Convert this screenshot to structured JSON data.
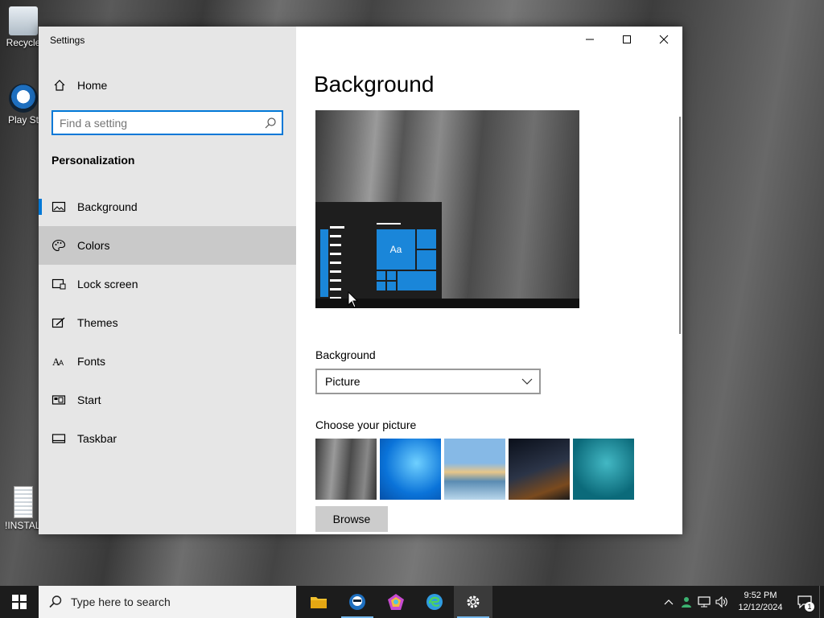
{
  "desktop": {
    "icons": [
      {
        "label": "Recycle",
        "icon": "recycle-bin-icon"
      },
      {
        "label": "Play St",
        "icon": "play-store-icon"
      },
      {
        "label": "!INSTALL",
        "icon": "install-file-icon"
      }
    ]
  },
  "window": {
    "title": "Settings",
    "controls": {
      "minimize": "minimize-icon",
      "maximize": "maximize-icon",
      "close": "close-icon"
    }
  },
  "sidebar": {
    "home_label": "Home",
    "search_placeholder": "Find a setting",
    "section_title": "Personalization",
    "items": [
      {
        "label": "Background",
        "icon": "picture-icon",
        "selected": true
      },
      {
        "label": "Colors",
        "icon": "palette-icon",
        "hover": true
      },
      {
        "label": "Lock screen",
        "icon": "lock-screen-icon"
      },
      {
        "label": "Themes",
        "icon": "themes-icon"
      },
      {
        "label": "Fonts",
        "icon": "fonts-icon"
      },
      {
        "label": "Start",
        "icon": "start-icon"
      },
      {
        "label": "Taskbar",
        "icon": "taskbar-icon"
      }
    ]
  },
  "main": {
    "title": "Background",
    "preview_tile_label": "Aa",
    "background_label": "Background",
    "background_value": "Picture",
    "choose_label": "Choose your picture",
    "browse_label": "Browse"
  },
  "taskbar": {
    "search_placeholder": "Type here to search",
    "apps": [
      {
        "name": "file-explorer-icon",
        "color": "#f2c12e"
      },
      {
        "name": "play-store-icon",
        "color": "#1e6fbf",
        "running": true
      },
      {
        "name": "colorful-app-icon",
        "color": "#c84bd1"
      },
      {
        "name": "edge-icon",
        "color": "#2f9ce0"
      },
      {
        "name": "settings-gear-icon",
        "color": "#ffffff",
        "active": true
      }
    ],
    "time": "9:52 PM",
    "date": "12/12/2024",
    "notification_count": "1"
  },
  "colors": {
    "accent": "#0078d7",
    "tile": "#1a86d9"
  }
}
